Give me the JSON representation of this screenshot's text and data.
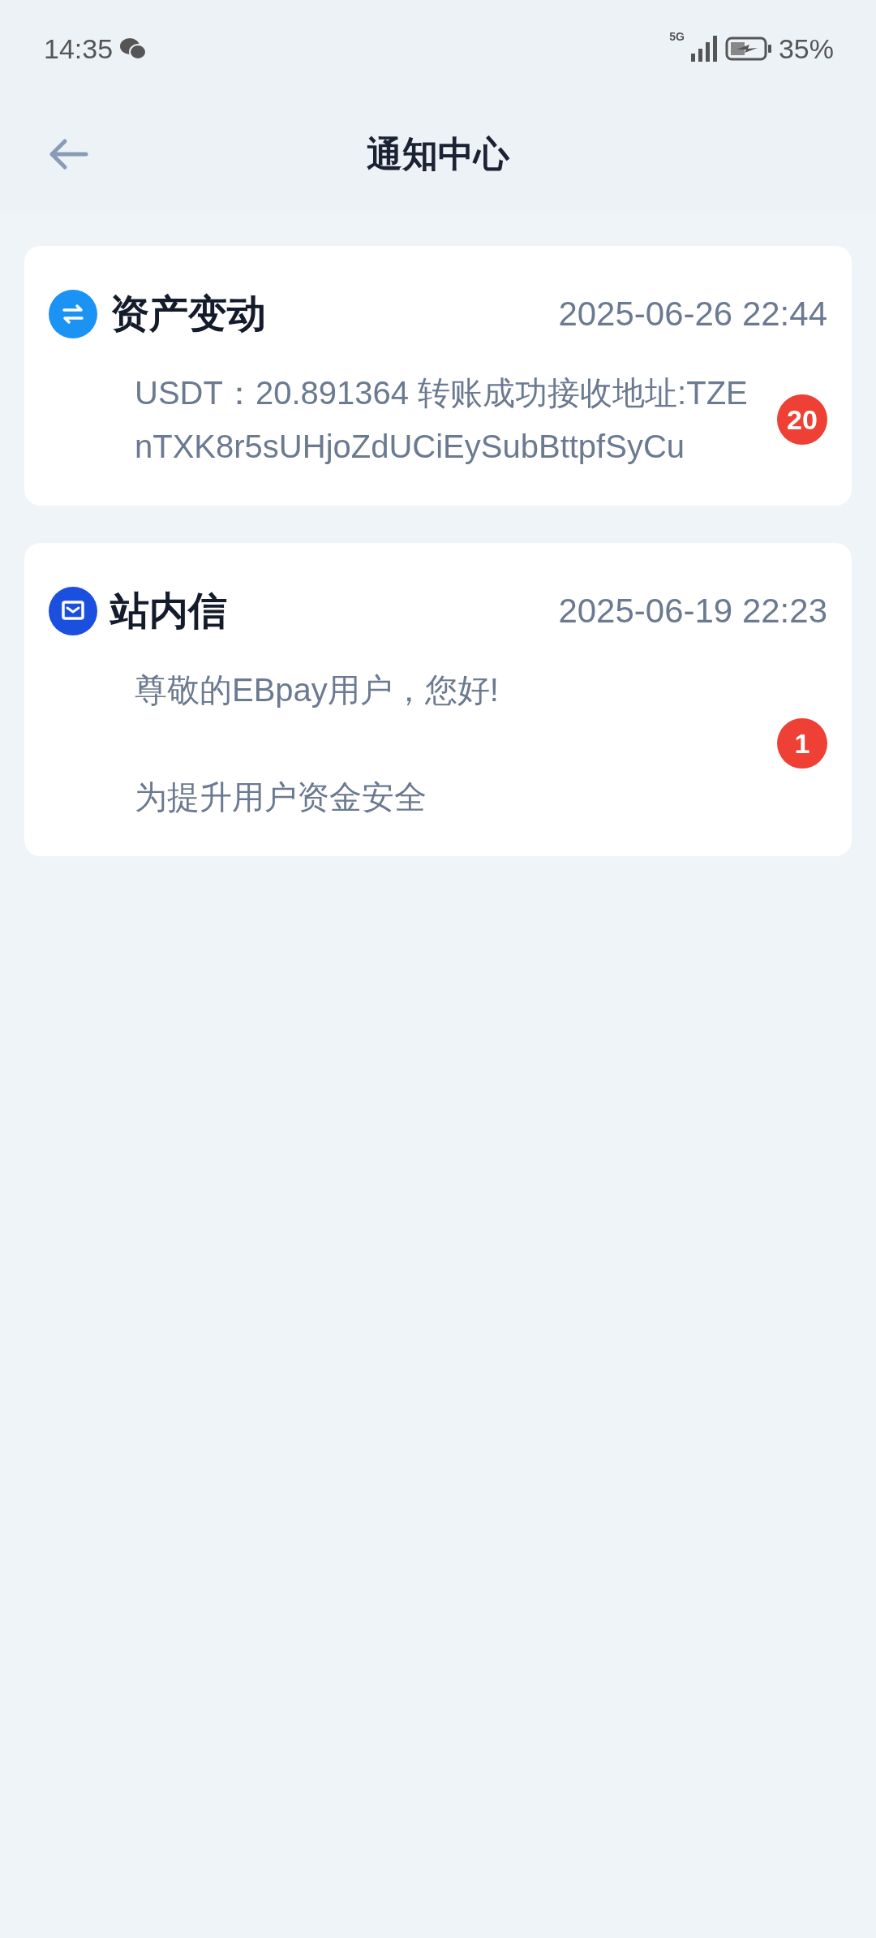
{
  "status_bar": {
    "time": "14:35",
    "network": "5G",
    "battery": "35%"
  },
  "header": {
    "title": "通知中心"
  },
  "notifications": [
    {
      "kind": "asset",
      "title": "资产变动",
      "time": "2025-06-26 22:44",
      "lines": [
        "USDT：20.891364 转账成功接收地址:TZEnTXK8r5sUHjoZdUCiEySubBttpfSyCu"
      ],
      "badge": "20"
    },
    {
      "kind": "mail",
      "title": "站内信",
      "time": "2025-06-19 22:23",
      "lines": [
        "尊敬的EBpay用户，您好!",
        "为提升用户资金安全"
      ],
      "badge": "1"
    }
  ]
}
